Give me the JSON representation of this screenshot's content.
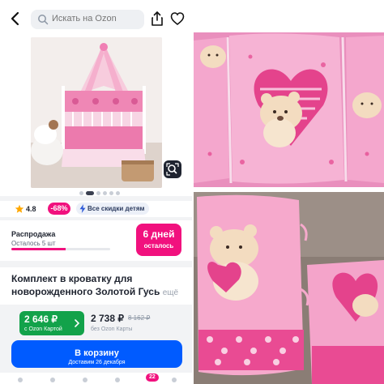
{
  "header": {
    "search_placeholder": "Искать на Ozon",
    "back_icon": "back-arrow-icon",
    "share_icon": "share-icon",
    "favorite_icon": "heart-icon"
  },
  "gallery": {
    "photo_count": 6,
    "active_index": 0
  },
  "badges": {
    "rating": "4.8",
    "discount": "-68%",
    "category_chip": "Все скидки детям"
  },
  "sale": {
    "title": "Распродажа",
    "remaining": "Осталось 5 шт",
    "remaining_fraction": 0.55,
    "days_value": "6 дней",
    "days_label": "осталось"
  },
  "product": {
    "title_line1": "Комплект в кроватку для",
    "title_line2": "новорожденного Золотой Гусь",
    "more_label": "ещё"
  },
  "price": {
    "ozon_card_price": "2 646 ₽",
    "ozon_card_label": "с Ozon Картой",
    "regular_price": "2 738 ₽",
    "old_price": "8 162 ₽",
    "regular_label": "без Ozon Карты"
  },
  "cart": {
    "button_label": "В корзину",
    "delivery": "Доставим 26 декабря",
    "count": "22"
  },
  "colors": {
    "accent_pink": "#f1117e",
    "ozon_blue": "#005bff",
    "ozon_green": "#12a24a",
    "bedding_pink": "#f07fb4"
  }
}
